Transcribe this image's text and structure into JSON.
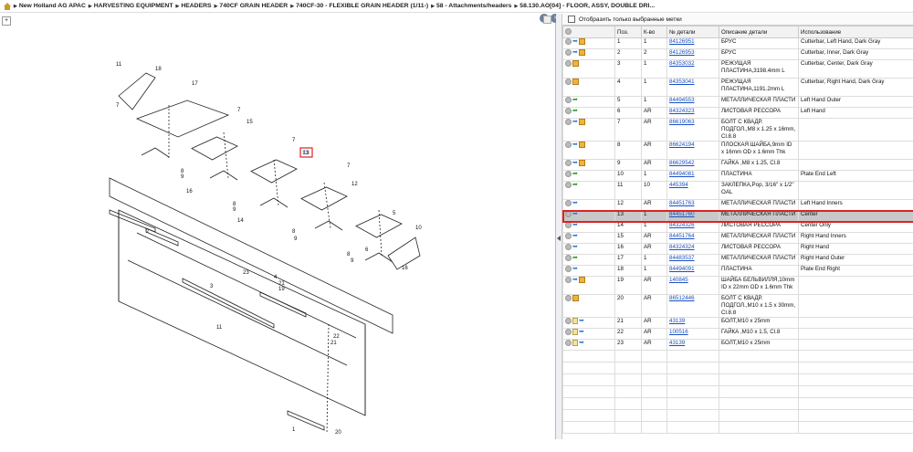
{
  "breadcrumbs": [
    "New Holland AG APAC",
    "HARVESTING EQUIPMENT",
    "HEADERS",
    "740CF GRAIN HEADER",
    "740CF-30 - FLEXIBLE GRAIN HEADER (1/11-)",
    "58 - Attachments/headers",
    "58.130.AO[04] - FLOOR, ASSY, DOUBLE DRI..."
  ],
  "filter_label": "Отобразить только выбранные метки",
  "columns": {
    "pos": "Поз.",
    "qty": "К-во",
    "part": "№ детали",
    "desc": "Описание детали",
    "usage": "Использование"
  },
  "selected_callout": "13",
  "parts": [
    {
      "icons": [
        "gray",
        "arrow",
        "box"
      ],
      "pos": "1",
      "qty": "1",
      "part": "84126951",
      "desc": "БРУС",
      "usage": "Cutterbar, Left Hand, Dark Gray"
    },
    {
      "icons": [
        "gray",
        "arrow",
        "box"
      ],
      "pos": "2",
      "qty": "2",
      "part": "84126953",
      "desc": "БРУС",
      "usage": "Cutterbar, Inner, Dark Gray"
    },
    {
      "icons": [
        "gray",
        "box"
      ],
      "pos": "3",
      "qty": "1",
      "part": "84353032",
      "desc": "РЕЖУЩАЯ ПЛАСТИНА,3198.4mm L",
      "usage": "Cutterbar, Center, Dark Gray"
    },
    {
      "icons": [
        "gray",
        "box"
      ],
      "pos": "4",
      "qty": "1",
      "part": "84353041",
      "desc": "РЕЖУЩАЯ ПЛАСТИНА,1191.2mm L",
      "usage": "Cutterbar, Right Hand, Dark Gray"
    },
    {
      "icons": [
        "gray",
        "green"
      ],
      "pos": "5",
      "qty": "1",
      "part": "84494553",
      "desc": "МЕТАЛЛИЧЕСКАЯ ПЛАСТИ",
      "usage": "Left Hand Outer"
    },
    {
      "icons": [
        "gray",
        "green"
      ],
      "pos": "6",
      "qty": "AR",
      "part": "84324323",
      "desc": "ЛИСТОВАЯ РЕССОРА",
      "usage": "Left Hand"
    },
    {
      "icons": [
        "gray",
        "arrow",
        "box"
      ],
      "pos": "7",
      "qty": "AR",
      "part": "86619063",
      "desc": "БОЛТ С КВАДР. ПОДГОЛ.,M8 x 1.25 x 16mm, Cl.8.8",
      "usage": ""
    },
    {
      "icons": [
        "gray",
        "arrow",
        "box"
      ],
      "pos": "8",
      "qty": "AR",
      "part": "86624194",
      "desc": "ПЛОСКАЯ ШАЙБА,9mm ID x 16mm OD x 1.6mm Thk",
      "usage": ""
    },
    {
      "icons": [
        "gray",
        "arrow",
        "box"
      ],
      "pos": "9",
      "qty": "AR",
      "part": "86629542",
      "desc": "ГАЙКА ,M8 x 1.25, Cl.8",
      "usage": ""
    },
    {
      "icons": [
        "gray",
        "green"
      ],
      "pos": "10",
      "qty": "1",
      "part": "84494081",
      "desc": "ПЛАСТИНА",
      "usage": "Plate End Left"
    },
    {
      "icons": [
        "gray",
        "green"
      ],
      "pos": "11",
      "qty": "10",
      "part": "445394",
      "desc": "ЗАКЛЕПКА,Pop, 3/16\" x 1/2\" OAL",
      "usage": ""
    },
    {
      "icons": [
        "gray",
        "arrow"
      ],
      "pos": "12",
      "qty": "AR",
      "part": "84451763",
      "desc": "МЕТАЛЛИЧЕСКАЯ ПЛАСТИ",
      "usage": "Left Hand Inners"
    },
    {
      "icons": [
        "gray",
        "arrow"
      ],
      "pos": "13",
      "qty": "1",
      "part": "84451760",
      "desc": "МЕТАЛЛИЧЕСКАЯ ПЛАСТИ",
      "usage": "Center",
      "selected": true
    },
    {
      "icons": [
        "gray",
        "arrow"
      ],
      "pos": "14",
      "qty": "1",
      "part": "84324326",
      "desc": "ЛИСТОВАЯ РЕССОРА",
      "usage": "Center Only"
    },
    {
      "icons": [
        "gray",
        "arrow"
      ],
      "pos": "15",
      "qty": "AR",
      "part": "84451764",
      "desc": "МЕТАЛЛИЧЕСКАЯ ПЛАСТИ",
      "usage": "Right Hand Inners"
    },
    {
      "icons": [
        "gray",
        "arrow"
      ],
      "pos": "16",
      "qty": "AR",
      "part": "84324324",
      "desc": "ЛИСТОВАЯ РЕССОРА",
      "usage": "Right Hand"
    },
    {
      "icons": [
        "gray",
        "green"
      ],
      "pos": "17",
      "qty": "1",
      "part": "84483537",
      "desc": "МЕТАЛЛИЧЕСКАЯ ПЛАСТИ",
      "usage": "Right Hand Outer"
    },
    {
      "icons": [
        "gray",
        "arrow"
      ],
      "pos": "18",
      "qty": "1",
      "part": "84494091",
      "desc": "ПЛАСТИНА",
      "usage": "Plate End Right"
    },
    {
      "icons": [
        "gray",
        "arrow",
        "box"
      ],
      "pos": "19",
      "qty": "AR",
      "part": "140845",
      "desc": "ШАЙБА БЕЛЬВИЛЛЯ,10mm ID x 22mm OD x 1.6mm Thk",
      "usage": ""
    },
    {
      "icons": [
        "gray",
        "box"
      ],
      "pos": "20",
      "qty": "AR",
      "part": "86512446",
      "desc": "БОЛТ С КВАДР. ПОДГОЛ.,M10 x 1.5 x 30mm, Cl.8.8",
      "usage": ""
    },
    {
      "icons": [
        "gray",
        "doc",
        "arrow"
      ],
      "pos": "21",
      "qty": "AR",
      "part": "43139",
      "desc": "БОЛТ,M10 x 25mm",
      "usage": ""
    },
    {
      "icons": [
        "gray",
        "doc",
        "arrow"
      ],
      "pos": "22",
      "qty": "AR",
      "part": "100516",
      "desc": "ГАЙКА ,M10 x 1.5, Cl.8",
      "usage": ""
    },
    {
      "icons": [
        "gray",
        "doc",
        "arrow"
      ],
      "pos": "23",
      "qty": "AR",
      "part": "43139",
      "desc": "БОЛТ,M10 x 25mm",
      "usage": ""
    }
  ],
  "callouts": [
    "1",
    "2",
    "3",
    "4",
    "5",
    "6",
    "7",
    "7",
    "7",
    "7",
    "8",
    "8",
    "8",
    "8",
    "9",
    "9",
    "9",
    "9",
    "10",
    "11",
    "11",
    "12",
    "13",
    "14",
    "15",
    "16",
    "16",
    "17",
    "18",
    "19",
    "20",
    "21",
    "21",
    "22",
    "23"
  ]
}
